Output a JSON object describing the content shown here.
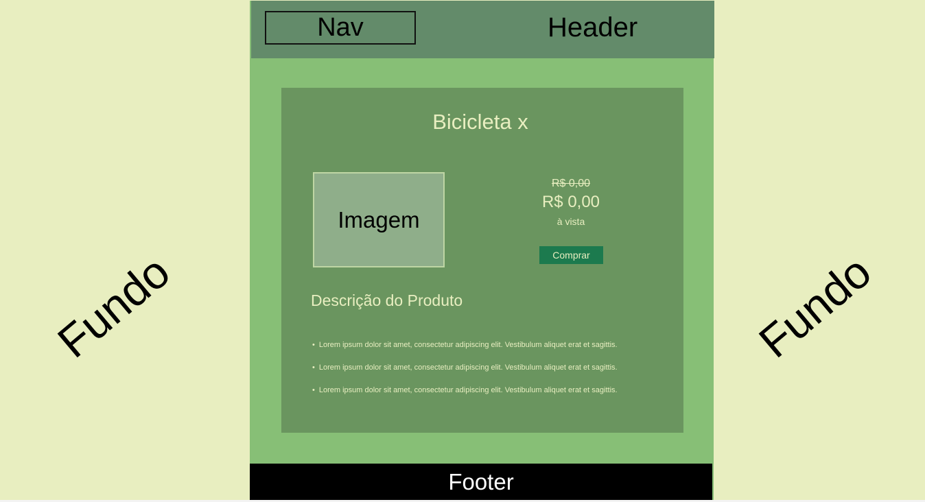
{
  "background": {
    "left_label": "Fundo",
    "right_label": "Fundo"
  },
  "header": {
    "nav_label": "Nav",
    "title": "Header"
  },
  "product": {
    "title": "Bicicleta x",
    "image_label": "Imagem",
    "old_price": "R$ 0,00",
    "price": "R$ 0,00",
    "payment_note": "à vista",
    "buy_label": "Comprar"
  },
  "description": {
    "title": "Descrição do Produto",
    "items": [
      "Lorem ipsum dolor sit amet, consectetur adipiscing elit. Vestibulum aliquet erat et sagittis.",
      "Lorem ipsum dolor sit amet, consectetur adipiscing elit. Vestibulum aliquet erat et sagittis.",
      "Lorem ipsum dolor sit amet, consectetur adipiscing elit. Vestibulum aliquet erat et sagittis."
    ]
  },
  "footer": {
    "label": "Footer"
  },
  "colors": {
    "background": "#e8eec0",
    "page": "#87bf76",
    "header": "#638b6a",
    "card": "#6a955f",
    "button": "#1c7a4e",
    "footer": "#000000"
  }
}
